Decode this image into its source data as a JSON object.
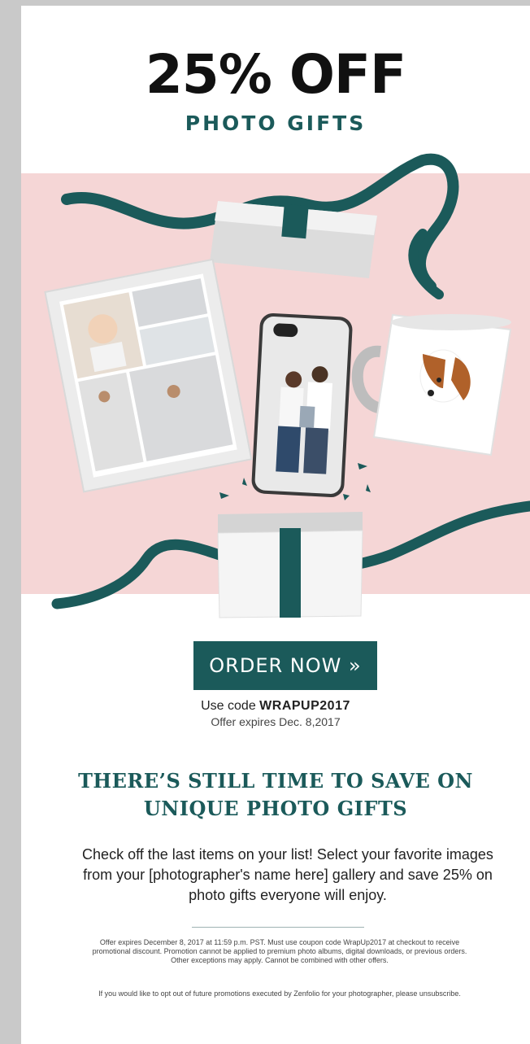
{
  "headline": "25% OFF",
  "subhead": "PHOTO GIFTS",
  "hero": {
    "image_label": "Photo gifts: framed collage, phone case, mug, gift box with teal ribbon",
    "colors": {
      "pink": "#f5d6d6",
      "teal": "#1b5a5a"
    }
  },
  "cta": {
    "order_label": "ORDER NOW",
    "order_icon": "double-chevron-right-icon",
    "code_prefix": "Use code ",
    "code": "WRAPUP2017",
    "expires": "Offer expires Dec. 8,2017"
  },
  "section": {
    "title": "THERE’S STILL TIME TO SAVE ON UNIQUE PHOTO GIFTS",
    "body": "Check off the last items on your list! Select your favorite images from your [photographer's name here] gallery and save 25% on photo gifts everyone will enjoy."
  },
  "footer": {
    "fine_print": "Offer expires December 8, 2017 at 11:59 p.m. PST. Must use coupon code WrapUp2017 at checkout to receive promotional discount. Promotion cannot be applied to premium photo albums, digital downloads, or previous orders. Other exceptions may apply. Cannot be combined with other offers.",
    "optout": "If you would like to opt out of future promotions executed by Zenfolio for your photographer, please unsubscribe."
  }
}
